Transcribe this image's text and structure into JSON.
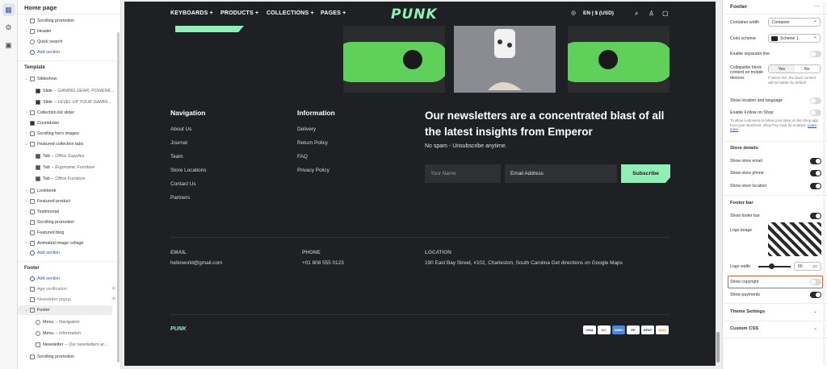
{
  "sidebar": {
    "title": "Home page",
    "top_items": [
      {
        "label": "Scrolling promotion"
      },
      {
        "label": "Header"
      },
      {
        "label": "Quick search"
      }
    ],
    "add_section": "Add section",
    "template_heading": "Template",
    "template_items": [
      {
        "label": "Slideshow"
      },
      {
        "label": "Slide",
        "sub": "– GAMING GEAR, POWERE..."
      },
      {
        "label": "Slide",
        "sub": "– LEVEL UP YOUR GAMIN..."
      },
      {
        "label": "Collection list slider"
      },
      {
        "label": "Countdown"
      },
      {
        "label": "Scrolling hero images"
      },
      {
        "label": "Featured collection tabs"
      },
      {
        "label": "Tab",
        "sub": "– Office Supplies"
      },
      {
        "label": "Tab",
        "sub": "– Ergonomic Furniture"
      },
      {
        "label": "Tab",
        "sub": "– Office Furniture"
      },
      {
        "label": "Lookbook"
      },
      {
        "label": "Featured product"
      },
      {
        "label": "Testimonial"
      },
      {
        "label": "Scrolling promotion"
      },
      {
        "label": "Featured blog"
      },
      {
        "label": "Animated image collage"
      }
    ],
    "footer_heading": "Footer",
    "footer_items": [
      {
        "label": "Age verification"
      },
      {
        "label": "Newsletter popup"
      },
      {
        "label": "Footer"
      },
      {
        "label": "Menu",
        "sub": "– Navigation"
      },
      {
        "label": "Menu",
        "sub": "– Information"
      },
      {
        "label": "Newsletter",
        "sub": "– Our newsletters ar..."
      },
      {
        "label": "Scrolling promotion"
      }
    ]
  },
  "preview": {
    "nav": [
      "KEYBOARDS +",
      "PRODUCTS +",
      "COLLECTIONS +",
      "PAGES +"
    ],
    "logo": "PUNK",
    "locale": "EN | $ (USD)",
    "navigation_title": "Navigation",
    "navigation_links": [
      "About Us",
      "Journal",
      "Team",
      "Store Locations",
      "Contact Us",
      "Partners"
    ],
    "information_title": "Information",
    "information_links": [
      "Delivery",
      "Return Policy",
      "FAQ",
      "Privacy Policy"
    ],
    "newsletter_title": "Our newsletters are a concentrated blast of all the latest insights from Emperor",
    "newsletter_sub": "No spam - Unsubscribe anytime.",
    "name_placeholder": "Your Name",
    "email_placeholder": "Email Address",
    "subscribe": "Subscribe",
    "email_label": "EMAIL",
    "email_value": "helloworld@gmail.com",
    "phone_label": "PHONE",
    "phone_value": "+01 808 555 0123",
    "location_label": "LOCATION",
    "location_value": "190 East Bay Street, #102, Charleston, South Carolina Get directions on Google Maps",
    "bottom_logo": "PUNK",
    "payments": [
      "VISA",
      "MC",
      "AMEX",
      "PP",
      "DPAY",
      "DISC"
    ]
  },
  "panel": {
    "title": "Footer",
    "container_width_label": "Container width",
    "container_width_value": "Container",
    "color_scheme_label": "Color scheme",
    "color_scheme_value": "Scheme 1",
    "separator_label": "Enable separator line",
    "collapsible_label": "Collapsible block content on mobile devices",
    "yes": "Yes",
    "no": "No",
    "collapsible_help": "If select Yes, the block content will be hidden by default",
    "show_location_label": "Show location and language",
    "follow_shop_label": "Enable Follow on Shop",
    "follow_shop_help": "To allow customers to follow your store on the Shop app from your storefront, Shop Pay must be enabled.",
    "learn_more": "Learn more",
    "store_details_heading": "Store details",
    "store_email_label": "Show store email",
    "store_phone_label": "Show store phone",
    "store_location_label": "Show store location",
    "footer_bar_heading": "Footer bar",
    "show_footer_bar_label": "Show footer bar",
    "logo_image_label": "Logo image",
    "logo_width_label": "Logo width",
    "logo_width_value": "60",
    "logo_width_unit": "px",
    "show_copyright_label": "Show copyright",
    "show_payments_label": "Show payments",
    "theme_settings": "Theme Settings",
    "custom_css": "Custom CSS"
  },
  "colors": {
    "accent": "#8ef0b4",
    "preview_bg": "#1f2023",
    "highlight": "#d4603a"
  }
}
